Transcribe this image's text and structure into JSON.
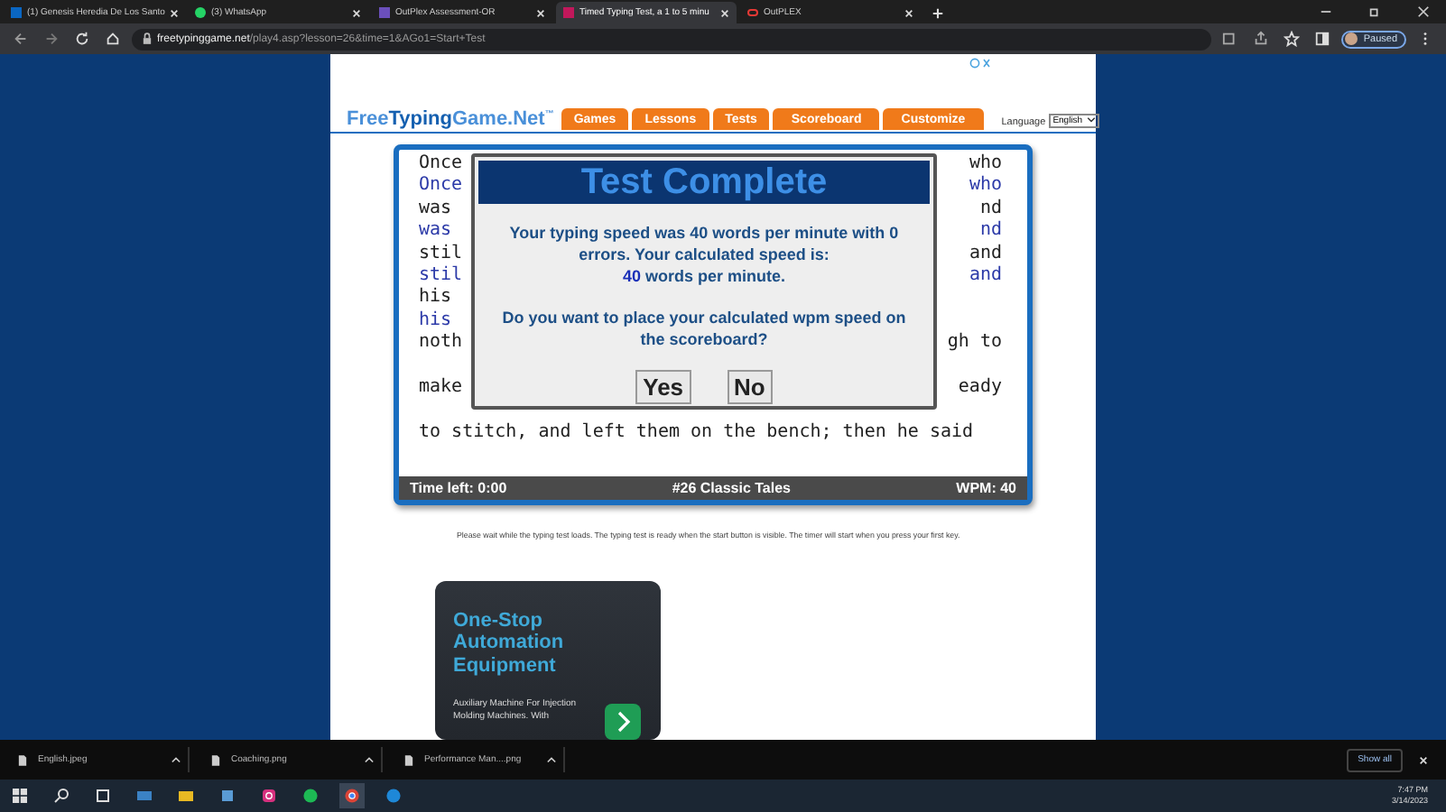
{
  "browser": {
    "tabs": [
      {
        "title": "(1) Genesis Heredia De Los Santo",
        "color": "#0a66c2",
        "selected": false
      },
      {
        "title": "(3) WhatsApp",
        "color": "#25d366",
        "selected": false
      },
      {
        "title": "OutPlex Assessment-OR",
        "color": "#6b4fbb",
        "selected": false
      },
      {
        "title": "Timed Typing Test, a 1 to 5 minu",
        "color": "#c2185b",
        "selected": true
      },
      {
        "title": "OutPLEX",
        "color": "#e53935",
        "selected": false
      }
    ],
    "url_host": "freetypinggame.net",
    "url_path": "/play4.asp?lesson=26&time=1&AGo1=Start+Test",
    "profile": "Paused"
  },
  "site": {
    "logo": "Free**Typing**Game.Net$^{™}$",
    "nav": [
      {
        "label": "Games"
      },
      {
        "label": "Lessons"
      },
      {
        "label": "Tests"
      },
      {
        "label": "Scoreboard"
      },
      {
        "label": "Customize"
      }
    ],
    "language_label": "Language",
    "language_value": "English"
  },
  "typing_test": {
    "rows": [
      {
        "source_left": "Once",
        "source_right": "who",
        "typed_left": "Once",
        "typed_right": "who"
      },
      {
        "source_left": "was",
        "source_right": "nd",
        "typed_left": "was",
        "typed_right": "nd"
      },
      {
        "source_left": "stil",
        "source_right": "and",
        "typed_left": "stil",
        "typed_right": "and"
      },
      {
        "source_left": "his",
        "typed_left": "his"
      },
      {
        "source_left": "noth",
        "source_right": "gh to"
      },
      {
        "source_left": "make",
        "source_right": "eady"
      },
      {
        "source_left": "to stitch, and left them on the bench; then he said"
      }
    ],
    "status": {
      "time_left": "Time left: 0:00",
      "lesson": "#26 Classic Tales",
      "wpm": "WPM: 40"
    }
  },
  "dialog": {
    "title": "Test Complete",
    "result": "Your typing speed was 40 words per minute with 0 errors. Your calculated speed is:",
    "speed_value": "40",
    "speed_unit": "words per minute.",
    "question": "Do you want to place your calculated wpm speed on the scoreboard?",
    "buttons": [
      "Yes",
      "No"
    ]
  },
  "instructions": "Please wait while the typing test loads. The typing test is ready when the start button is visible. The timer will start when you press your first key.",
  "ad": {
    "title": "One-Stop Automation Equipment",
    "body": "Auxiliary Machine For Injection Molding Machines. With"
  },
  "downloads": {
    "items": [
      "English.jpeg",
      "Coaching.png",
      "Performance Man....png"
    ],
    "show_all": "Show all"
  },
  "taskbar": {
    "time": "7:47 PM",
    "date": "3/14/2023"
  }
}
